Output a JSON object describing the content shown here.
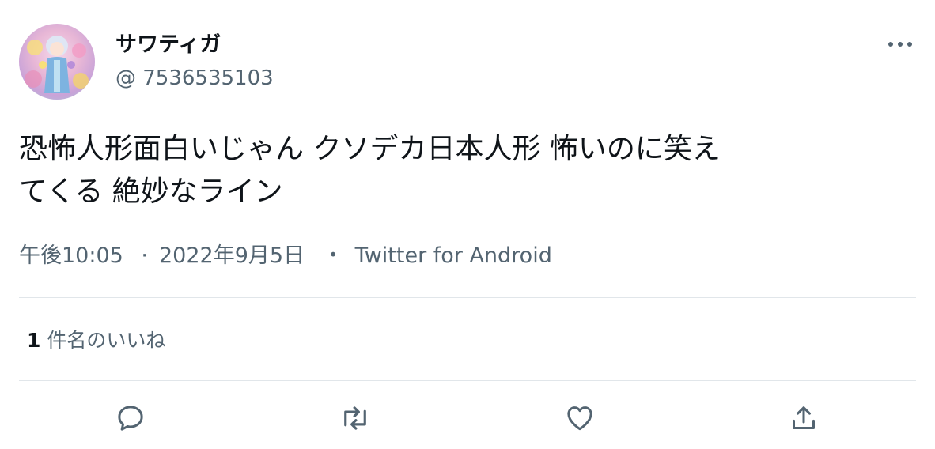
{
  "user": {
    "display_name": "サワティガ",
    "handle": "@ 7536535103"
  },
  "tweet": {
    "text": "恐怖人形面白いじゃん クソデカ日本人形 怖いのに笑え\nてくる 絶妙なライン",
    "time": "午後10:05",
    "date": "2022年9月5日",
    "separator_1": "·",
    "separator_2": "・",
    "source": "Twitter for Android"
  },
  "likes": {
    "count": "1",
    "label": "件名のいいね"
  },
  "icons": {
    "more": "more-horizontal-icon",
    "reply": "reply-icon",
    "retweet": "retweet-icon",
    "like": "heart-icon",
    "share": "share-icon"
  },
  "colors": {
    "text": "#0f1419",
    "secondary": "#536471",
    "divider": "#e1e6ea",
    "icon": "#536471"
  }
}
